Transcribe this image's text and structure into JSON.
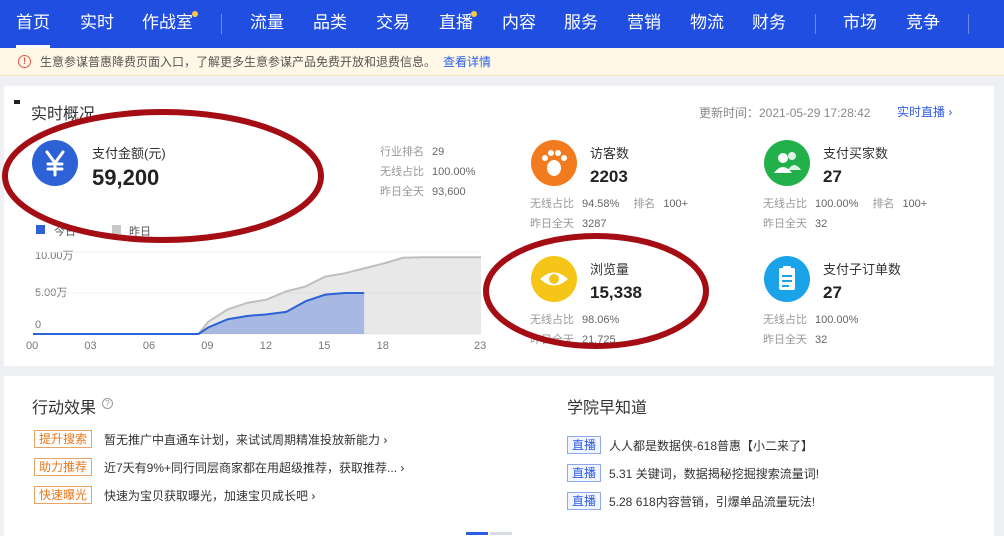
{
  "nav": {
    "items": [
      {
        "label": "首页",
        "active": true
      },
      {
        "label": "实时"
      },
      {
        "label": "作战室",
        "dot": true
      },
      {
        "label": "流量"
      },
      {
        "label": "品类"
      },
      {
        "label": "交易"
      },
      {
        "label": "直播",
        "dot": true
      },
      {
        "label": "内容"
      },
      {
        "label": "服务"
      },
      {
        "label": "营销"
      },
      {
        "label": "物流"
      },
      {
        "label": "财务"
      },
      {
        "label": "市场"
      },
      {
        "label": "竞争"
      }
    ]
  },
  "notice": {
    "text": "生意参谋普惠降费页面入口，了解更多生意参谋产品免费开放和退费信息。",
    "link": "查看详情"
  },
  "realtime": {
    "title": "实时概况",
    "update_time": "更新时间：2021-05-29 17:28:42",
    "live_link": "实时直播 ›",
    "payment": {
      "label": "支付金额(元)",
      "value": "59,200",
      "stats": [
        {
          "k": "行业排名",
          "v": "29"
        },
        {
          "k": "无线占比",
          "v": "100.00%"
        },
        {
          "k": "昨日全天",
          "v": "93,600"
        }
      ]
    },
    "visitors": {
      "label": "访客数",
      "value": "2203",
      "line1": {
        "k": "无线占比",
        "v": "94.58%",
        "k2": "排名",
        "v2": "100+"
      },
      "line2": {
        "k": "昨日全天",
        "v": "3287"
      }
    },
    "buyers": {
      "label": "支付买家数",
      "value": "27",
      "line1": {
        "k": "无线占比",
        "v": "100.00%",
        "k2": "排名",
        "v2": "100+"
      },
      "line2": {
        "k": "昨日全天",
        "v": "32"
      }
    },
    "pageviews": {
      "label": "浏览量",
      "value": "15,338",
      "line1": {
        "k": "无线占比",
        "v": "98.06%"
      },
      "line2": {
        "k": "昨日全天",
        "v": "21,725"
      }
    },
    "suborders": {
      "label": "支付子订单数",
      "value": "27",
      "line1": {
        "k": "无线占比",
        "v": "100.00%"
      },
      "line2": {
        "k": "昨日全天",
        "v": "32"
      }
    }
  },
  "chart_data": {
    "type": "area",
    "legend": [
      "今日",
      "昨日"
    ],
    "y_ticks": [
      "10.00万",
      "5.00万",
      "0"
    ],
    "x_ticks": [
      "00",
      "03",
      "06",
      "09",
      "12",
      "15",
      "18",
      "23"
    ],
    "ylim": [
      0,
      100000
    ],
    "xlim": [
      0,
      23
    ],
    "series": [
      {
        "name": "今日",
        "color": "#2d62d6",
        "x": [
          0,
          8.5,
          9,
          10,
          11,
          12,
          13,
          14,
          15,
          16,
          17
        ],
        "y": [
          0,
          0,
          8000,
          18000,
          22000,
          24000,
          27000,
          40000,
          48000,
          50000,
          50000
        ]
      },
      {
        "name": "昨日",
        "color": "#bfbfbf",
        "x": [
          0,
          8.5,
          9,
          10,
          11,
          12,
          13,
          14,
          15,
          16,
          17,
          18,
          19,
          20,
          21,
          22,
          23
        ],
        "y": [
          0,
          0,
          15000,
          30000,
          38000,
          42000,
          52000,
          58000,
          70000,
          74000,
          80000,
          86000,
          93000,
          93600,
          93600,
          93600,
          93600
        ]
      }
    ]
  },
  "actions": {
    "title": "行动效果",
    "items": [
      {
        "tag": "提升搜索",
        "text": "暂无推广中直通车计划，来试试周期精准投放新能力 ›"
      },
      {
        "tag": "助力推荐",
        "text": "近7天有9%+同行同层商家都在用超级推荐，获取推荐... ›"
      },
      {
        "tag": "快速曝光",
        "text": "快速为宝贝获取曝光，加速宝贝成长吧 ›"
      }
    ]
  },
  "academy": {
    "title": "学院早知道",
    "items": [
      {
        "badge": "直播",
        "text": "人人都是数据侠-618普惠【小二来了】"
      },
      {
        "badge": "直播",
        "text": "5.31 关键词，数据揭秘挖掘搜索流量词!"
      },
      {
        "badge": "直播",
        "text": "5.28 618内容营销，引爆单品流量玩法!"
      }
    ]
  },
  "colors": {
    "nav_bg": "#1f4ee0",
    "accent": "#2d5ce6",
    "annotation": "#a50d14"
  }
}
